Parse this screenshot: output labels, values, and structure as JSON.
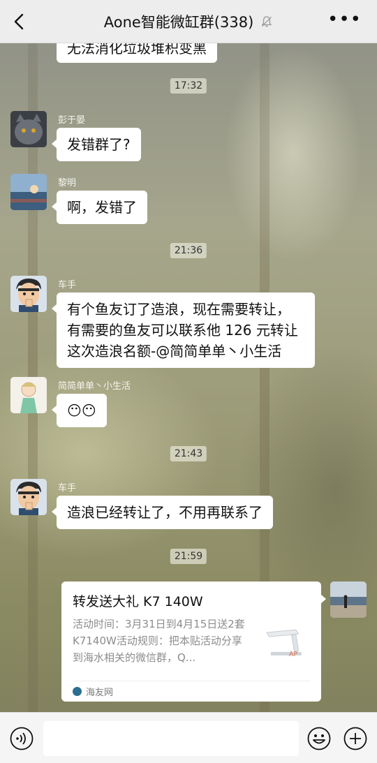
{
  "header": {
    "title": "Aone智能微缸群(338)"
  },
  "messages": {
    "partial_text": "无法消化垃圾堆积变黑",
    "time1": "17:32",
    "m1": {
      "sender": "彭于晏",
      "text": "发错群了?"
    },
    "m2": {
      "sender": "黎明",
      "text": "啊，发错了"
    },
    "time2": "21:36",
    "m3": {
      "sender": "车手",
      "line1": "有个鱼友订了造浪，现在需要转让，",
      "line2": "有需要的鱼友可以联系他 126 元转让",
      "line3": "这次造浪名额-@简简单单丶小生活"
    },
    "m4": {
      "sender": "简简单单丶小生活",
      "text": "😶😶"
    },
    "time3": "21:43",
    "m5": {
      "sender": "车手",
      "text": "造浪已经转让了，不用再联系了"
    },
    "time4": "21:59",
    "card": {
      "title": "转发送大礼 K7 140W",
      "desc": "活动时间：3月31日到4月15日送2套K7140W活动规则：把本贴活动分享到海水相关的微信群，Q...",
      "source": "海友网"
    }
  },
  "colors": {
    "header_bg": "#ededed",
    "bubble_bg": "#ffffff",
    "input_bar_bg": "#f5f5f5"
  }
}
